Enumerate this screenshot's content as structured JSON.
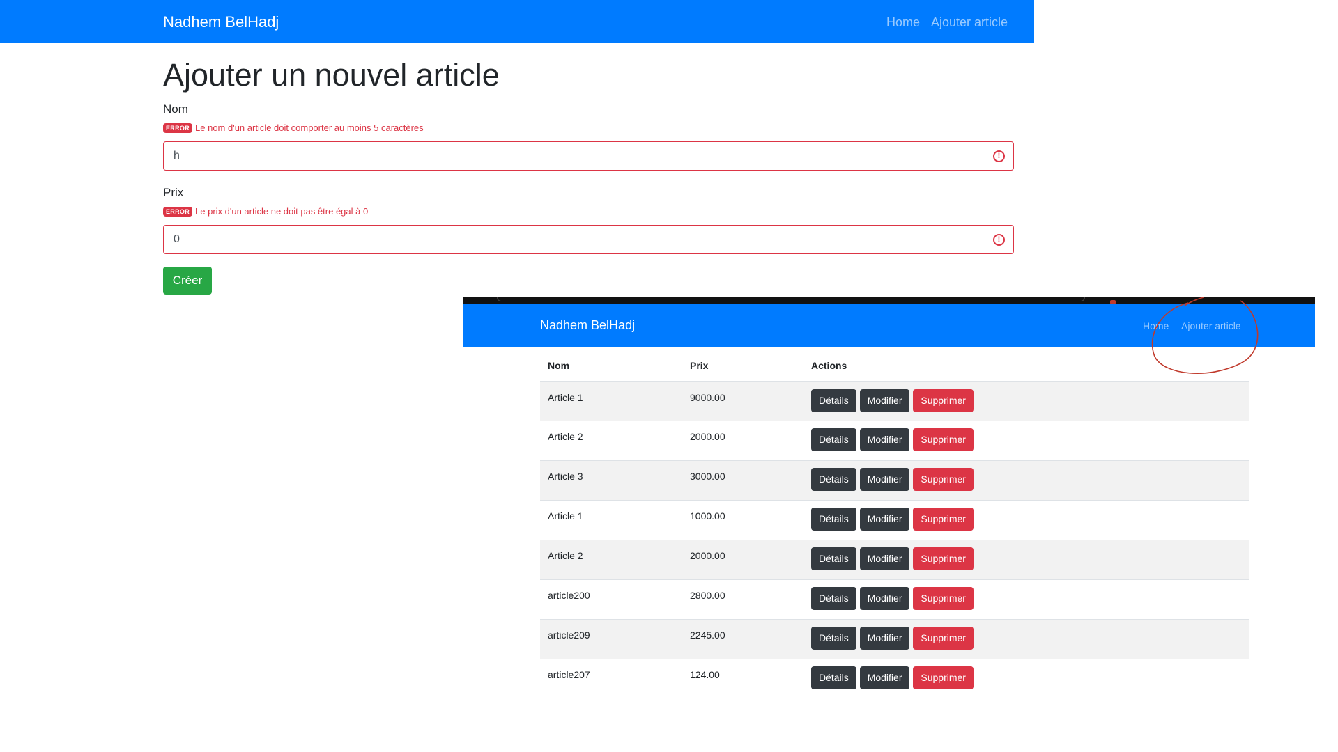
{
  "form_page": {
    "navbar": {
      "brand": "Nadhem BelHadj",
      "links": [
        "Home",
        "Ajouter article"
      ]
    },
    "title": "Ajouter un nouvel article",
    "fields": [
      {
        "label": "Nom",
        "error_badge": "ERROR",
        "error": "Le nom d'un article doit comporter au moins 5 caractères",
        "value": "h"
      },
      {
        "label": "Prix",
        "error_badge": "ERROR",
        "error": "Le prix d'un article ne doit pas être égal à 0",
        "value": "0"
      }
    ],
    "submit_label": "Créer"
  },
  "list_page": {
    "navbar": {
      "brand": "Nadhem BelHadj",
      "links": [
        "Home",
        "Ajouter article"
      ]
    },
    "table": {
      "headers": [
        "Nom",
        "Prix",
        "Actions"
      ],
      "action_labels": [
        "Détails",
        "Modifier",
        "Supprimer"
      ],
      "rows": [
        {
          "nom": "Article 1",
          "prix": "9000.00"
        },
        {
          "nom": "Article 2",
          "prix": "2000.00"
        },
        {
          "nom": "Article 3",
          "prix": "3000.00"
        },
        {
          "nom": "Article 1",
          "prix": "1000.00"
        },
        {
          "nom": "Article 2",
          "prix": "2000.00"
        },
        {
          "nom": "article200",
          "prix": "2800.00"
        },
        {
          "nom": "article209",
          "prix": "2245.00"
        },
        {
          "nom": "article207",
          "prix": "124.00"
        }
      ]
    }
  },
  "colors": {
    "primary": "#007bff",
    "success": "#28a745",
    "danger": "#dc3545",
    "dark": "#343a40"
  },
  "icons": {
    "invalid": "exclamation-circle-icon"
  }
}
